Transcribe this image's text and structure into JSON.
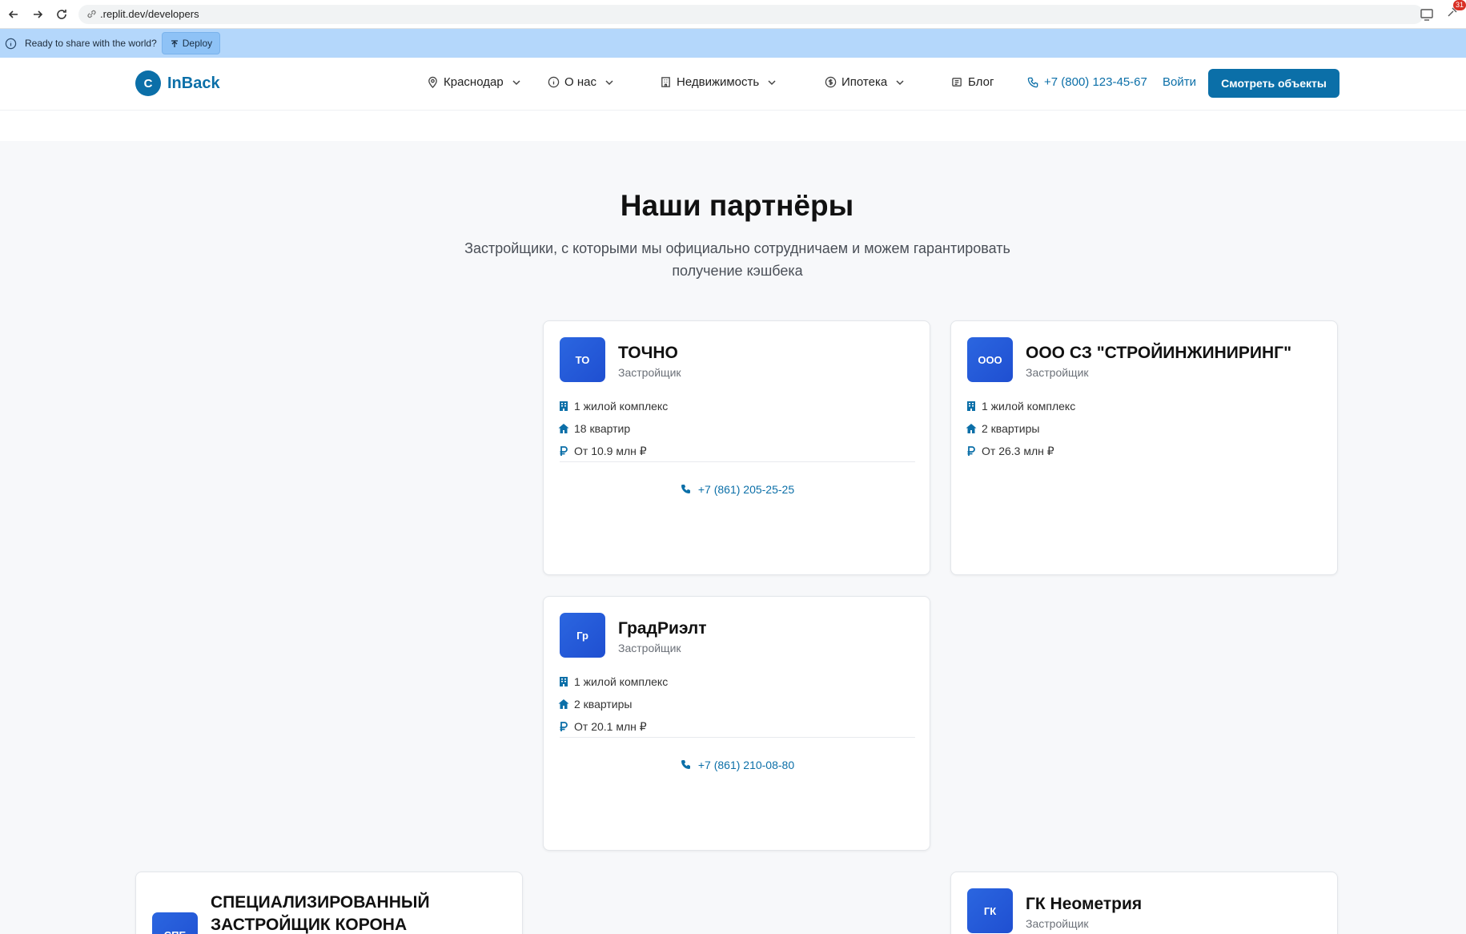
{
  "browser": {
    "url": ".replit.dev/developers",
    "extension_badge": "31"
  },
  "banner": {
    "text": "Ready to share with the world?",
    "deploy_label": "Deploy"
  },
  "header": {
    "logo_letter": "C",
    "logo_text": "InBack",
    "nav": {
      "city": "Краснодар",
      "about": "О нас",
      "realty": "Недвижимость",
      "mortgage": "Ипотека",
      "blog": "Блог",
      "phone": "+7 (800) 123-45-67"
    },
    "login": "Войти",
    "cta": "Смотреть объекты"
  },
  "section": {
    "title": "Наши партнёры",
    "subtitle_line1": "Застройщики, с которыми мы официально сотрудничаем и можем гарантировать",
    "subtitle_line2": "получение кэшбека"
  },
  "cards": [
    {
      "avatar": "ТО",
      "name": "ТОЧНО",
      "type": "Застройщик",
      "complexes": "1 жилой комплекс",
      "apartments": "18 квартир",
      "price": "От 10.9 млн ₽",
      "phone": "+7 (861) 205-25-25"
    },
    {
      "avatar": "ООО",
      "name": "ООО СЗ \"СТРОЙИНЖИНИРИНГ\"",
      "type": "Застройщик",
      "complexes": "1 жилой комплекс",
      "apartments": "2 квартиры",
      "price": "От 26.3 млн ₽"
    },
    {
      "avatar": "Гр",
      "name": "ГрадРиэлт",
      "type": "Застройщик",
      "complexes": "1 жилой комплекс",
      "apartments": "2 квартиры",
      "price": "От 20.1 млн ₽",
      "phone": "+7 (861) 210-08-80"
    },
    {
      "avatar": "СПЕ",
      "name_line1": "СПЕЦИАЛИЗИРОВАННЫЙ",
      "name_line2": "ЗАСТРОЙЩИК КОРОНА"
    },
    {
      "avatar": "ГК",
      "name": "ГК Неометрия",
      "type": "Застройщик"
    }
  ]
}
